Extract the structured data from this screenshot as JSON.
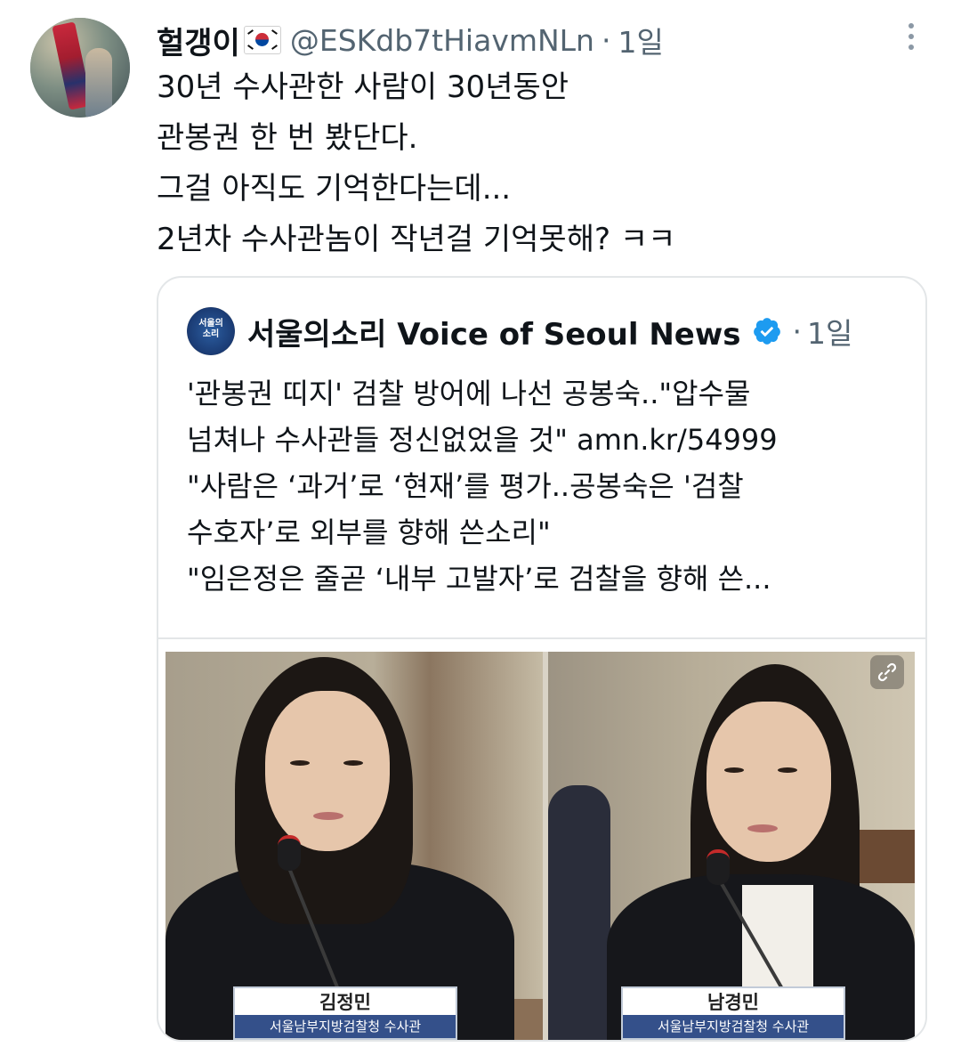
{
  "tweet": {
    "author_name": "헐갱이",
    "author_flag_icon": "south-korea-flag-icon",
    "handle": "@ESKdb7tHiavmNLn",
    "separator": "·",
    "time": "1일",
    "lines": [
      "30년 수사관한 사람이 30년동안",
      "관봉권 한 번 봤단다.",
      "그걸 아직도 기억한다는데...",
      "2년차 수사관놈이 작년걸 기억못해? ㅋㅋ"
    ]
  },
  "quoted": {
    "logo_text": "서울의\n소리",
    "name": "서울의소리 Voice of Seoul News",
    "verified_icon": "verified-badge-icon",
    "separator": "·",
    "time": "1일",
    "lines": [
      "'관봉권 띠지' 검찰 방어에 나선 공봉숙..\"압수물",
      "넘쳐나 수사관들 정신없었을 것\" amn.kr/54999",
      "\"사람은 ‘과거’로 ‘현재’를 평가..공봉숙은 '검찰",
      "수호자’로 외부를 향해 쓴소리\"",
      "\"임은정은 줄곧 ‘내부 고발자’로 검찰을 향해 쓴..."
    ],
    "media": {
      "left_caption_name": "김정민",
      "left_caption_role": "서울남부지방검찰청 수사관",
      "right_caption_name": "남경민",
      "right_caption_role": "서울남부지방검찰청 수사관"
    }
  },
  "colors": {
    "text": "#0f1419",
    "secondary": "#536471",
    "border": "#e3e6e8",
    "verified": "#1d9bf0",
    "caption_bar": "#34508a"
  }
}
